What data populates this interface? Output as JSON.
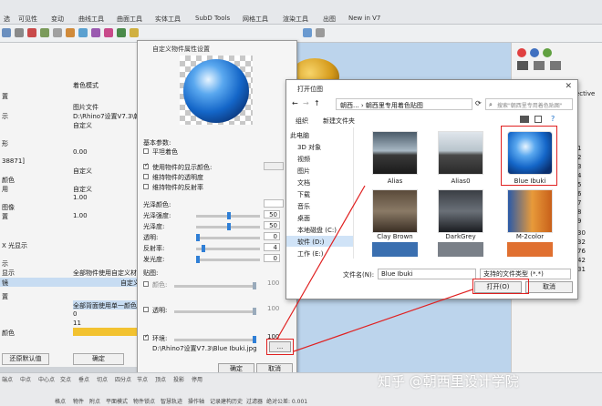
{
  "menu": {
    "tabs": [
      "选",
      "可见性",
      "变动",
      "曲线工具",
      "曲面工具",
      "实体工具",
      "SubD Tools",
      "网格工具",
      "渲染工具",
      "出图",
      "New in V7"
    ]
  },
  "left_panel": {
    "shading_mode_value": "着色模式",
    "row_labels": [
      "置",
      "示",
      "形",
      "38871]",
      "颜色",
      "用",
      "图像",
      "置",
      "X 光显示",
      "示",
      "显示",
      "镜",
      "置",
      "颜色"
    ],
    "values": {
      "image_file": "图片文件",
      "image_path": "D:\\Rhino7设置V7.3\\朝西",
      "custom1": "自定义",
      "num1": "0.00",
      "custom2": "自定义",
      "custom3": "自定义",
      "num2": "1.00",
      "num3": "1.00",
      "all_objects": "全部物件使用自定义材质",
      "custom4": "自定义",
      "all_background": "全部背面使用单一颜色",
      "zero": "0",
      "eleven": "11"
    },
    "restore_default": "还原默认值",
    "ok": "确定"
  },
  "material_dialog": {
    "title": "自定义物件属性设置",
    "basic_params": "基本参数:",
    "flat_shading": "平坦着色",
    "use_display_color": "使用物件的显示颜色:",
    "use_transparency": "维持物件的透明度",
    "use_reflectivity": "维持物件的反射率",
    "gloss_color": "光泽颜色:",
    "gloss_intensity": "光泽强度:",
    "gloss_value": "50",
    "gloss_degree": "光泽度:",
    "gloss_degree_value": "50",
    "transparency": "透明:",
    "transparency_value": "0",
    "reflectivity": "反射率:",
    "reflectivity_value": "4",
    "luminance": "发光度:",
    "luminance_value": "0",
    "texture": "贴图:",
    "color_tex": "颜色:",
    "color_tex_value": "100",
    "transparent_tex": "透明:",
    "transparent_tex_value": "100",
    "env_tex": "环境:",
    "env_tex_value": "100",
    "env_path": "D:\\Rhino7设置V7.3\\Blue Ibuki.jpg",
    "browse": "...",
    "ok": "确定",
    "cancel": "取消"
  },
  "file_dialog": {
    "title": "打开位图",
    "breadcrumb": "朝西... › 朝西里专用着色贴图",
    "search_placeholder": "搜索\"朝西里专用着色贴图\"",
    "organize": "组织",
    "new_folder": "新建文件夹",
    "nav_items": [
      "此电脑",
      "3D 对象",
      "视频",
      "图片",
      "文档",
      "下载",
      "音乐",
      "桌面",
      "本地磁盘 (C:)",
      "软件 (D:)",
      "工作 (E:)"
    ],
    "thumbnails": [
      {
        "name": "Alias"
      },
      {
        "name": "Alias0"
      },
      {
        "name": "Blue Ibuki"
      },
      {
        "name": "Clay Brown"
      },
      {
        "name": "DarkGrey"
      },
      {
        "name": "M-2color"
      }
    ],
    "filename_label": "文件名(N):",
    "filename_value": "Blue Ibuki",
    "filetype_value": "支持的文件类型 (*.*)",
    "open": "打开(O)",
    "cancel": "取消"
  },
  "right_panel": {
    "text_fragments": [
      "ective"
    ],
    "numbers": [
      "1",
      "2",
      "3",
      "4",
      "5",
      "6",
      "7",
      "8",
      "9",
      "30",
      "32",
      "76",
      "42",
      "31"
    ]
  },
  "status_bar": {
    "options": [
      "格点",
      "物件",
      "附点",
      "平面模式",
      "物件锁点",
      "智慧轨迹",
      "操作轴",
      "记录建构历史",
      "过滤器",
      "绝对公差: 0.001"
    ],
    "left_items": [
      "端点",
      "中点",
      "中心点",
      "交点",
      "垂点",
      "切点",
      "四分点",
      "节点",
      "顶点",
      "投影",
      "停用"
    ]
  },
  "watermark": "知乎 @朝西里设计学院"
}
